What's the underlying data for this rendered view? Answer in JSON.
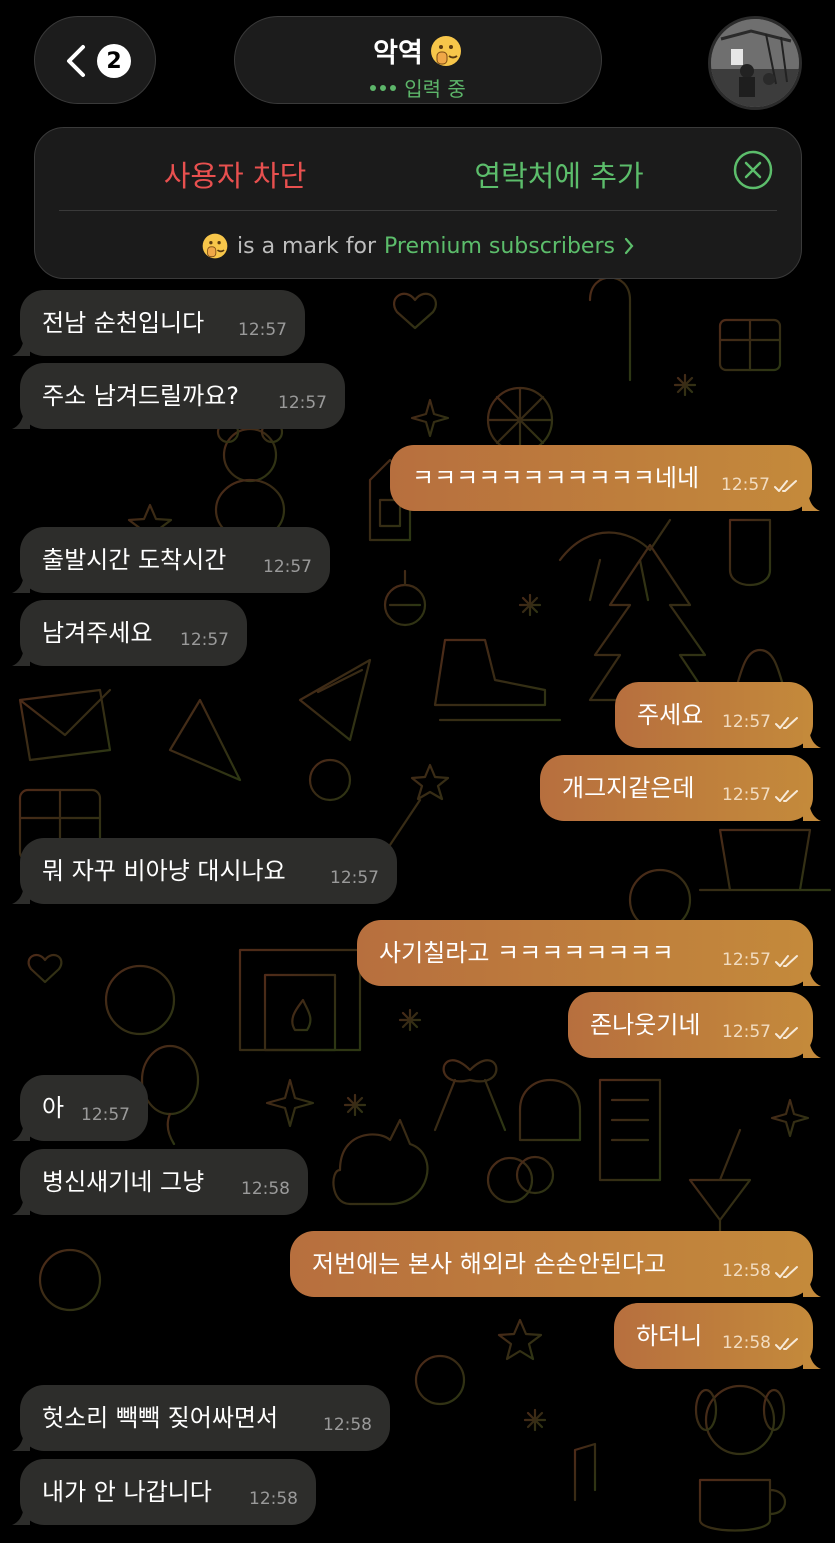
{
  "header": {
    "back_count": "2",
    "title": "악역",
    "status": "입력 중"
  },
  "banner": {
    "block_label": "사용자 차단",
    "add_contact_label": "연락처에 추가",
    "premium_text": "is a mark for",
    "premium_link": "Premium subscribers"
  },
  "colors": {
    "incoming_bubble": "#2d2d2b",
    "outgoing_bubble_start": "#b76f3e",
    "outgoing_bubble_end": "#c48a3b",
    "block_red": "#e8504f",
    "accent_green": "#5cbd6b"
  },
  "messages": [
    {
      "dir": "in",
      "text": "전남 순천입니다",
      "time": "12:57"
    },
    {
      "dir": "in",
      "text": "주소 남겨드릴까요?",
      "time": "12:57"
    },
    {
      "dir": "out",
      "text": "ㅋㅋㅋㅋㅋㅋㅋㅋㅋㅋㅋ네네",
      "time": "12:57",
      "read": true
    },
    {
      "dir": "in",
      "text": "출발시간 도착시간",
      "time": "12:57"
    },
    {
      "dir": "in",
      "text": "남겨주세요",
      "time": "12:57"
    },
    {
      "dir": "out",
      "text": "주세요",
      "time": "12:57",
      "read": true
    },
    {
      "dir": "out",
      "text": "개그지같은데",
      "time": "12:57",
      "read": true
    },
    {
      "dir": "in",
      "text": "뭐 자꾸 비아냥 대시나요",
      "time": "12:57"
    },
    {
      "dir": "out",
      "text": "사기칠라고 ㅋㅋㅋㅋㅋㅋㅋㅋ",
      "time": "12:57",
      "read": true
    },
    {
      "dir": "out",
      "text": "존나웃기네",
      "time": "12:57",
      "read": true
    },
    {
      "dir": "in",
      "text": "아",
      "time": "12:57"
    },
    {
      "dir": "in",
      "text": "병신새기네 그냥",
      "time": "12:58"
    },
    {
      "dir": "out",
      "text": "저번에는 본사 해외라 손손안된다고",
      "time": "12:58",
      "read": true
    },
    {
      "dir": "out",
      "text": "하더니",
      "time": "12:58",
      "read": true
    },
    {
      "dir": "in",
      "text": "헛소리 빽빽 짖어싸면서",
      "time": "12:58"
    },
    {
      "dir": "in",
      "text": "내가 안 나갑니다",
      "time": "12:58"
    }
  ]
}
